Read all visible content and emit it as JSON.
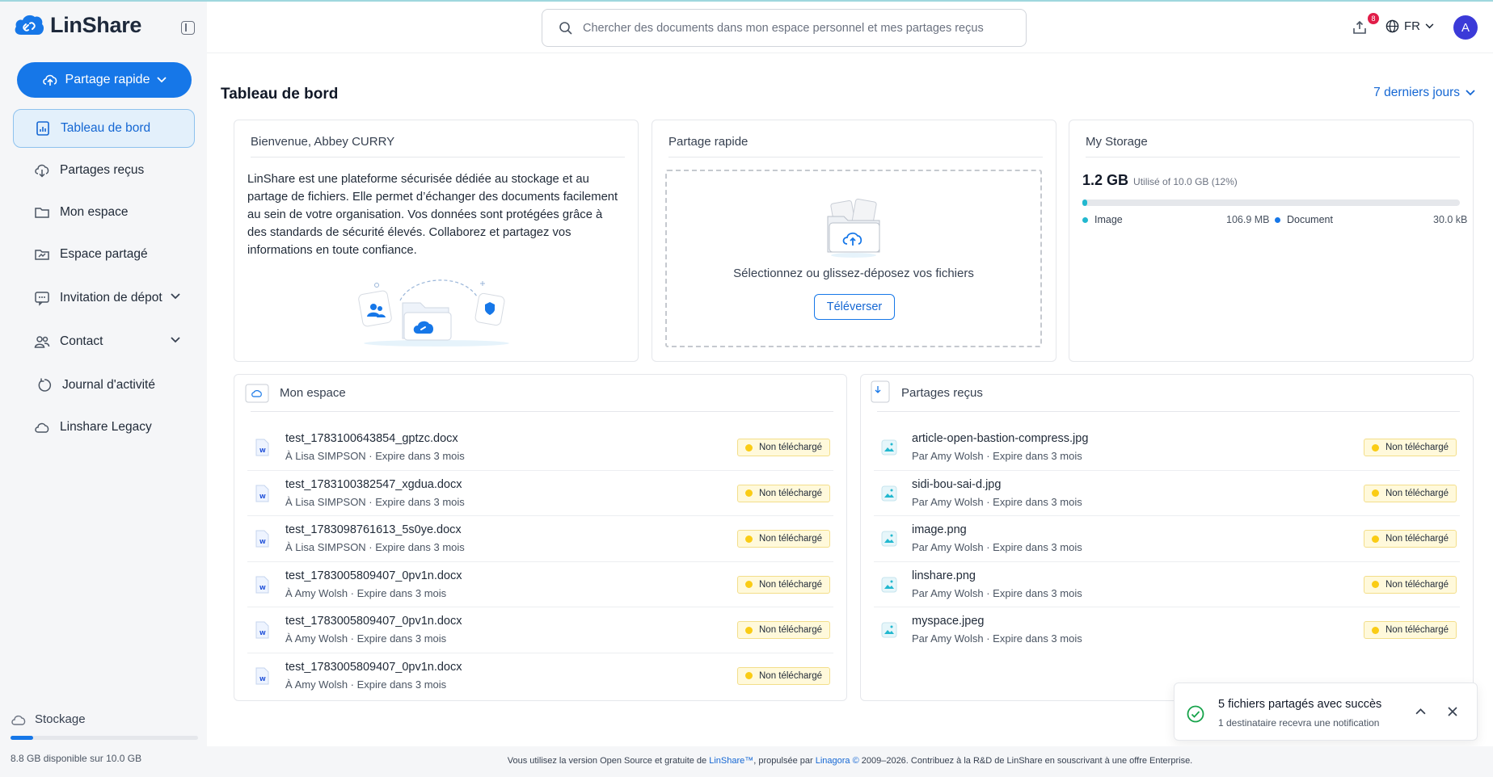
{
  "app": {
    "name": "LinShare"
  },
  "sidebar": {
    "quick_share_label": "Partage rapide",
    "items": [
      {
        "label": "Tableau de bord",
        "icon": "dashboard-icon",
        "active": true
      },
      {
        "label": "Partages reçus",
        "icon": "cloud-download-icon"
      },
      {
        "label": "Mon espace",
        "icon": "folder-icon"
      },
      {
        "label": "Espace partagé",
        "icon": "shared-folder-icon"
      },
      {
        "label": "Invitation de dépot",
        "icon": "invitation-icon",
        "expandable": true
      },
      {
        "label": "Contact",
        "icon": "contacts-icon",
        "expandable": true
      },
      {
        "label": "Journal d'activité",
        "icon": "history-icon"
      },
      {
        "label": "Linshare Legacy",
        "icon": "cloud-icon"
      }
    ],
    "storage": {
      "label": "Stockage",
      "text": "8.8 GB disponible sur 10.0 GB",
      "used_fraction": 0.12
    }
  },
  "header": {
    "search_placeholder": "Chercher des documents dans mon espace personnel et mes partages reçus",
    "upload_badge": "8",
    "language": "FR",
    "avatar_initial": "A"
  },
  "dashboard": {
    "title": "Tableau de bord",
    "period": "7 derniers jours",
    "welcome": {
      "title": "Bienvenue, Abbey CURRY",
      "text": "LinShare est une plateforme sécurisée dédiée au stockage et au partage de fichiers. Elle permet d’échanger des documents facilement au sein de votre organisation. Vos données sont protégées grâce à des standards de sécurité élevés. Collaborez et partagez vos informations en toute confiance."
    },
    "quick_share": {
      "title": "Partage rapide",
      "drop_text": "Sélectionnez ou glissez-déposez vos fichiers",
      "button": "Téléverser"
    },
    "storage": {
      "title": "My Storage",
      "used": "1.2 GB",
      "used_detail": "Utilisé of 10.0 GB (12%)",
      "used_fraction": 0.012,
      "image_label": "Image",
      "image_value": "106.9 MB",
      "doc_label": "Document",
      "doc_value": "30.0 kB",
      "image_color": "#22b8cf",
      "doc_color": "#1677e8"
    },
    "my_space": {
      "title": "Mon espace",
      "rows": [
        {
          "name": "test_1783100643854_gptzc.docx",
          "meta": "À Lisa SIMPSON · Expire dans 3 mois",
          "status": "Non téléchargé"
        },
        {
          "name": "test_1783100382547_xgdua.docx",
          "meta": "À Lisa SIMPSON · Expire dans 3 mois",
          "status": "Non téléchargé"
        },
        {
          "name": "test_1783098761613_5s0ye.docx",
          "meta": "À Lisa SIMPSON · Expire dans 3 mois",
          "status": "Non téléchargé"
        },
        {
          "name": "test_1783005809407_0pv1n.docx",
          "meta": "À Amy Wolsh · Expire dans 3 mois",
          "status": "Non téléchargé"
        },
        {
          "name": "test_1783005809407_0pv1n.docx",
          "meta": "À Amy Wolsh · Expire dans 3 mois",
          "status": "Non téléchargé"
        },
        {
          "name": "test_1783005809407_0pv1n.docx",
          "meta": "À Amy Wolsh · Expire dans 3 mois",
          "status": "Non téléchargé"
        }
      ]
    },
    "received": {
      "title": "Partages reçus",
      "rows": [
        {
          "name": "article-open-bastion-compress.jpg",
          "meta": "Par Amy Wolsh · Expire dans 3 mois",
          "status": "Non téléchargé"
        },
        {
          "name": "sidi-bou-sai-d.jpg",
          "meta": "Par Amy Wolsh · Expire dans 3 mois",
          "status": "Non téléchargé"
        },
        {
          "name": "image.png",
          "meta": "Par Amy Wolsh · Expire dans 3 mois",
          "status": "Non téléchargé"
        },
        {
          "name": "linshare.png",
          "meta": "Par Amy Wolsh · Expire dans 3 mois",
          "status": "Non téléchargé"
        },
        {
          "name": "myspace.jpeg",
          "meta": "Par Amy Wolsh · Expire dans 3 mois",
          "status": "Non téléchargé"
        }
      ]
    }
  },
  "toast": {
    "title": "5 fichiers partagés avec succès",
    "subtitle": "1 destinataire recevra une notification"
  },
  "footer": {
    "before": "Vous utilisez la version Open Source et gratuite de ",
    "link1": "LinShare™",
    "middle": ", propulsée par ",
    "link2": "Linagora ©",
    "after": " 2009–2026. Contribuez à la R&D de LinShare en souscrivant à une offre Enterprise."
  }
}
